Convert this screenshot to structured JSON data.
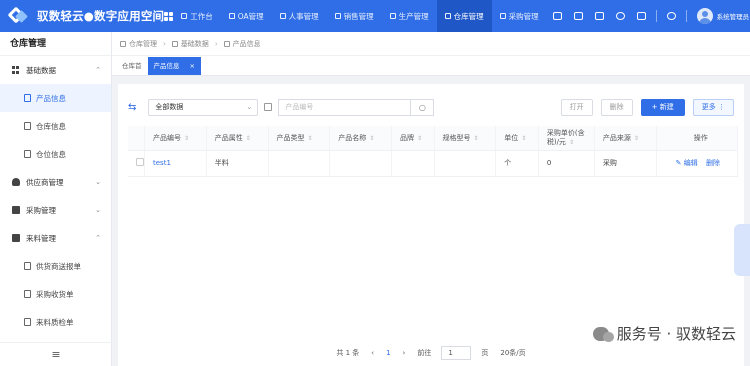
{
  "app": {
    "title": "驭数轻云●数字应用空间"
  },
  "nav": [
    {
      "label": "工作台",
      "active": false
    },
    {
      "label": "OA管理",
      "active": false
    },
    {
      "label": "人事管理",
      "active": false
    },
    {
      "label": "销售管理",
      "active": false
    },
    {
      "label": "生产管理",
      "active": false
    },
    {
      "label": "仓库管理",
      "active": true
    },
    {
      "label": "采购管理",
      "active": false
    }
  ],
  "user": {
    "name": "系统管理员"
  },
  "sidebar": {
    "title": "仓库管理",
    "groups": [
      {
        "label": "基础数据",
        "expanded": true,
        "items": [
          {
            "label": "产品信息",
            "active": true
          },
          {
            "label": "仓库信息",
            "active": false
          },
          {
            "label": "仓位信息",
            "active": false
          }
        ]
      },
      {
        "label": "供应商管理",
        "expanded": false,
        "items": []
      },
      {
        "label": "采购管理",
        "expanded": false,
        "items": []
      },
      {
        "label": "来料管理",
        "expanded": true,
        "items": [
          {
            "label": "供货商送报单",
            "active": false
          },
          {
            "label": "采购收货单",
            "active": false
          },
          {
            "label": "来料质检单",
            "active": false
          }
        ]
      }
    ]
  },
  "breadcrumb": [
    "仓库管理",
    "基础数据",
    "产品信息"
  ],
  "tabs": [
    {
      "label": "仓库首",
      "active": false
    },
    {
      "label": "产品信息",
      "active": true
    }
  ],
  "toolbar": {
    "select_value": "全部数据",
    "search_placeholder": "产品编号",
    "open_label": "打开",
    "delete_label": "删除",
    "add_label": "+ 新建",
    "more_label": "更多"
  },
  "table": {
    "columns": [
      "产品编号",
      "产品属性",
      "产品类型",
      "产品名称",
      "品牌",
      "规格型号",
      "单位",
      "采购单价(含税)/元",
      "产品来源",
      "操作"
    ],
    "rows": [
      {
        "cells": [
          "test1",
          "半料",
          "",
          "",
          "",
          "",
          "个",
          "0",
          "采购"
        ],
        "actions": [
          "编辑",
          "删除"
        ]
      }
    ]
  },
  "pager": {
    "total_text": "共 1 条",
    "current_page": "1",
    "goto_label": "前往",
    "goto_value": "1",
    "page_unit": "页",
    "page_size": "20条/页"
  },
  "brand_footer": "服务号 · 驭数轻云",
  "colors": {
    "primary": "#2f6ee6",
    "topbar": "#2f6ee6",
    "active_nav": "#1f57c7"
  }
}
